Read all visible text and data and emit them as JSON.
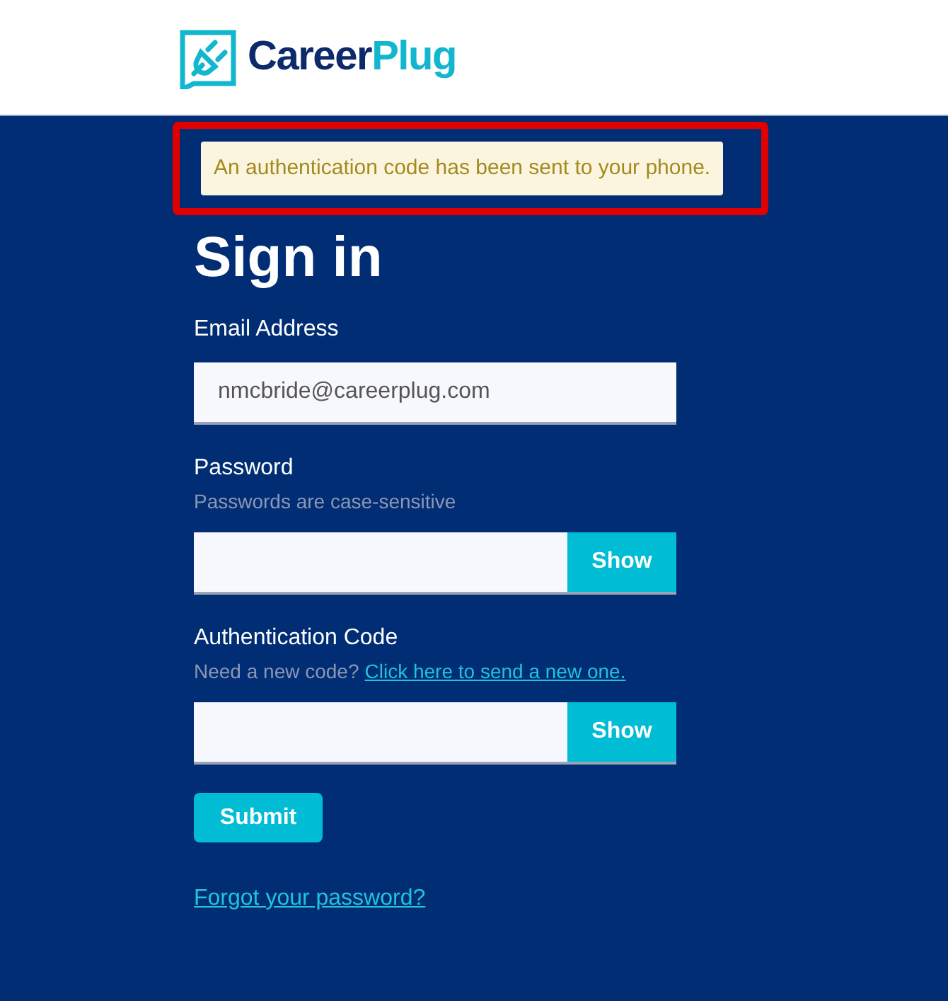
{
  "logo": {
    "parts": [
      "Career",
      "Plug"
    ]
  },
  "alert": {
    "text": "An authentication code has been sent to your phone.",
    "highlighted": true
  },
  "heading": "Sign in",
  "fields": [
    {
      "kind": "text",
      "label": "Email Address",
      "value": "nmcbride@careerplug.com"
    },
    {
      "kind": "password",
      "label": "Password",
      "hint": "Passwords are case-sensitive",
      "button": "Show"
    },
    {
      "kind": "password",
      "label": "Authentication Code",
      "hint": "Need a new code?",
      "link": "Click here to send a new one.",
      "button": "Show"
    }
  ],
  "submit": "Submit",
  "forgot_link": "Forgot your password?"
}
